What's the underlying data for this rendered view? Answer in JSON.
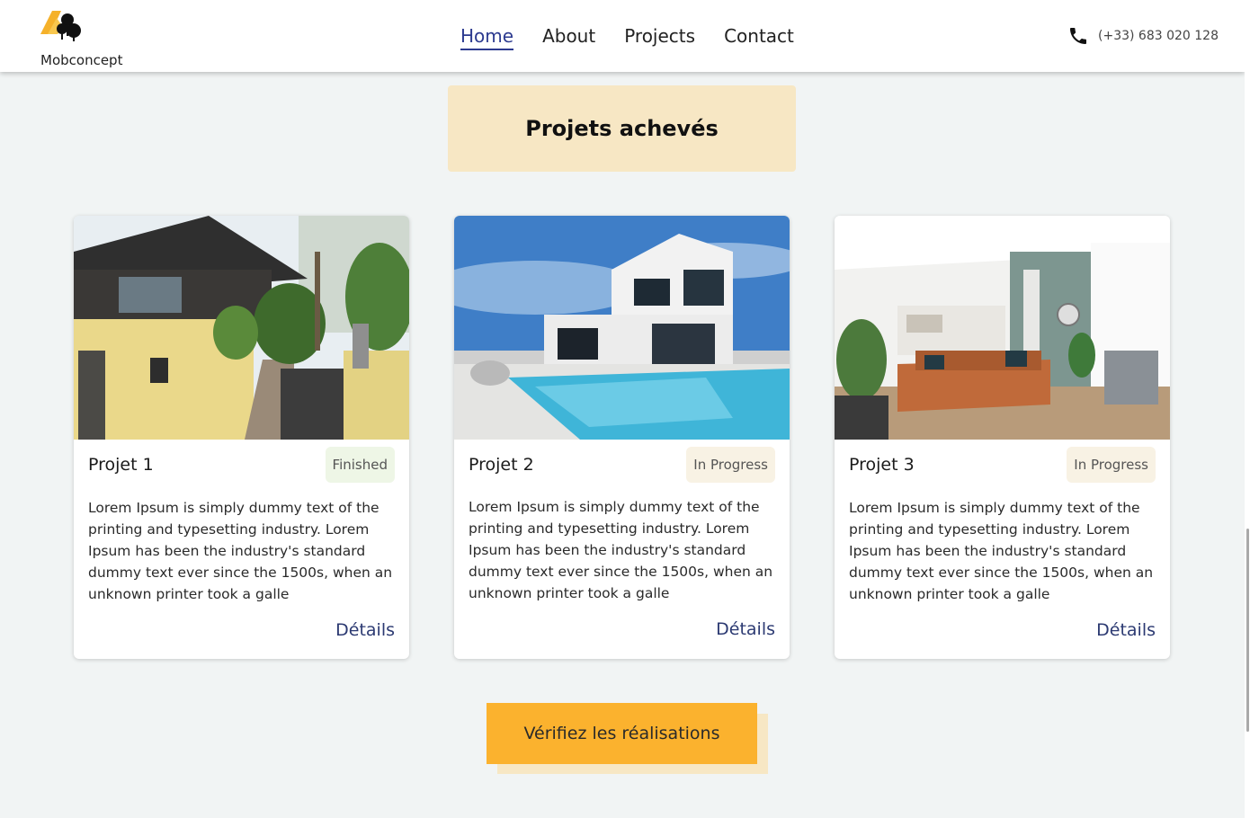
{
  "header": {
    "brand": "Mobconcept",
    "nav": [
      {
        "label": "Home",
        "active": true
      },
      {
        "label": "About",
        "active": false
      },
      {
        "label": "Projects",
        "active": false
      },
      {
        "label": "Contact",
        "active": false
      }
    ],
    "phone": "(+33) 683 020 128",
    "phone_icon": "phone-icon"
  },
  "section": {
    "title": "Projets achevés"
  },
  "projects": [
    {
      "title": "Projet 1",
      "status": "Finished",
      "description": "Lorem Ipsum is simply dummy text of the printing and typesetting industry. Lorem Ipsum has been the industry's standard dummy text ever since the 1500s, when an unknown printer took a galle",
      "details_label": "Détails"
    },
    {
      "title": "Projet 2",
      "status": "In Progress",
      "description": "Lorem Ipsum is simply dummy text of the printing and typesetting industry. Lorem Ipsum has been the industry's standard dummy text ever since the 1500s, when an unknown printer took a galle",
      "details_label": "Détails"
    },
    {
      "title": "Projet 3",
      "status": "In Progress",
      "description": "Lorem Ipsum is simply dummy text of the printing and typesetting industry. Lorem Ipsum has been the industry's standard dummy text ever since the 1500s, when an unknown printer took a galle",
      "details_label": "Détails"
    }
  ],
  "cta": {
    "label": "Vérifiez les réalisations"
  },
  "colors": {
    "accent": "#fbb22e",
    "nav_active": "#2c3a8f",
    "title_bg": "#f7e7c4",
    "page_bg": "#f1f4f4"
  }
}
